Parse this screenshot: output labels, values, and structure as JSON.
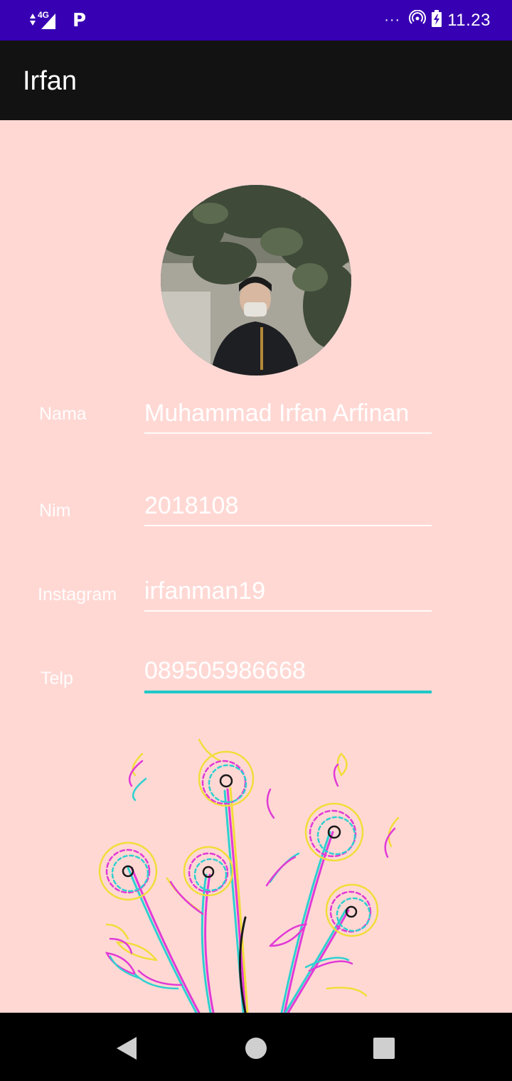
{
  "status_bar": {
    "network": "4G",
    "carrier_badge": "P",
    "overflow": "···",
    "time": "11.23",
    "icons": [
      "signal-icon",
      "parking-icon",
      "hotspot-icon",
      "battery-icon"
    ]
  },
  "app_bar": {
    "title": "Irfan"
  },
  "profile": {
    "photo": "profile-photo",
    "fields": [
      {
        "label": "Nama",
        "value": "Muhammad Irfan Arfinan",
        "focused": false
      },
      {
        "label": "Nim",
        "value": "2018108",
        "focused": false
      },
      {
        "label": "Instagram",
        "value": "irfanman19",
        "focused": false
      },
      {
        "label": "Telp",
        "value": "089505986668",
        "focused": true
      }
    ]
  },
  "decoration": "flower-illustration",
  "nav_bar": {
    "icons": [
      "back-icon",
      "home-icon",
      "recents-icon"
    ]
  },
  "colors": {
    "status_bar": "#3700B3",
    "app_bar": "#121212",
    "background": "#FFD8D4",
    "focus_accent": "#1EC8C8"
  }
}
